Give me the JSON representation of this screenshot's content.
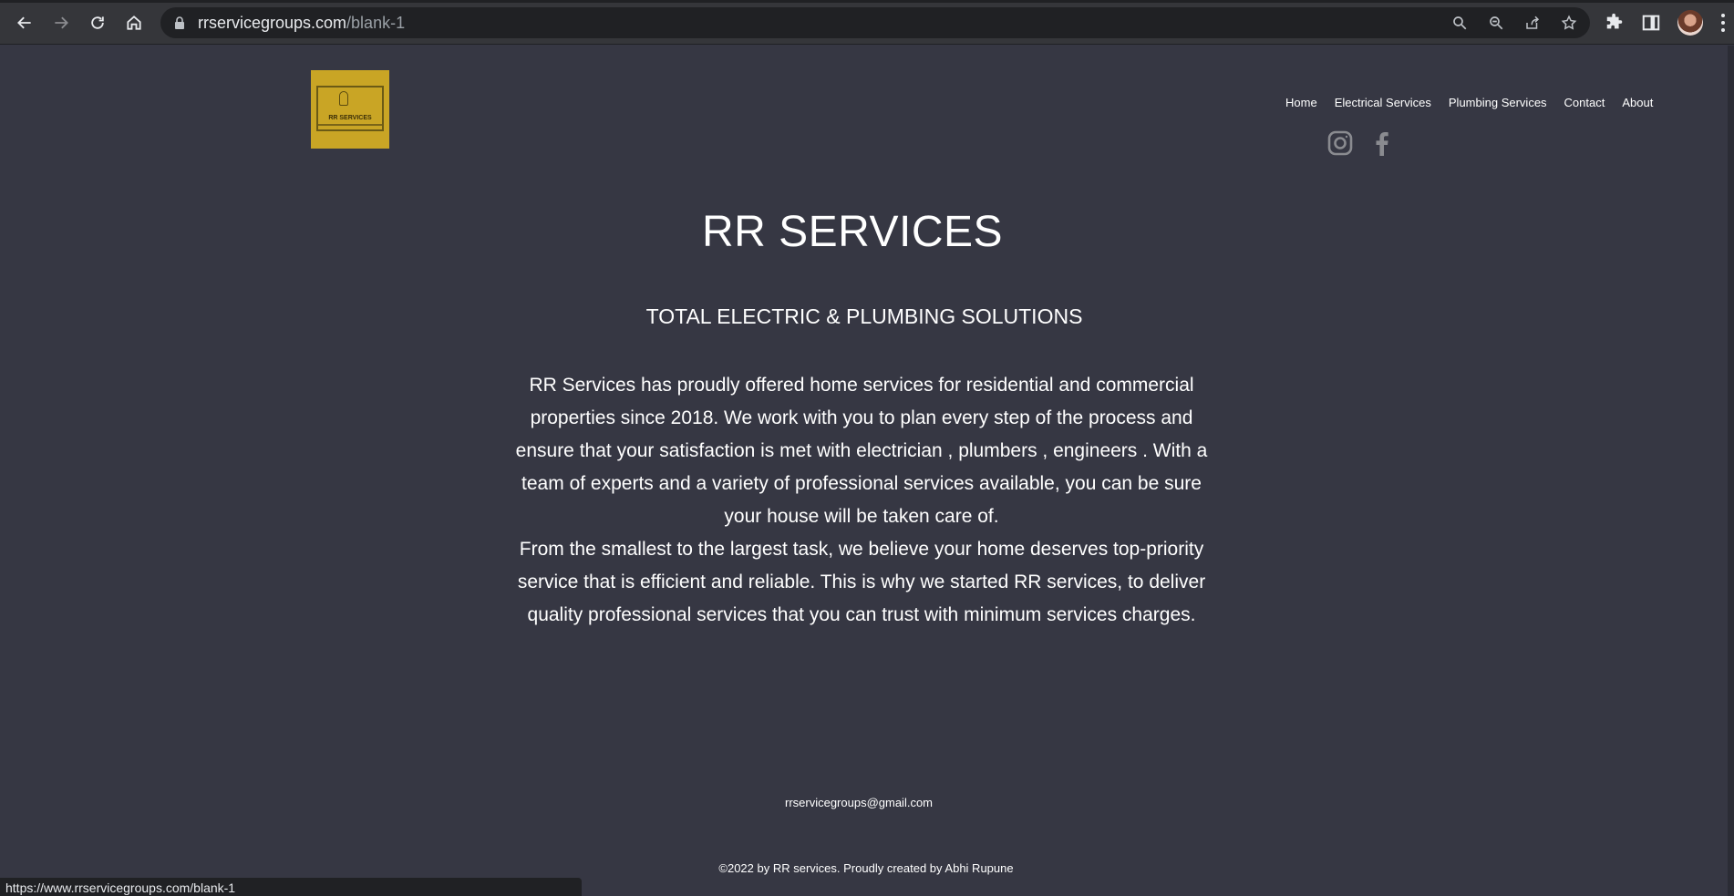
{
  "browser": {
    "url_host": "rrservicegroups.com",
    "url_path": "/blank-1",
    "icons": [
      "back-icon",
      "forward-icon",
      "reload-icon",
      "home-icon",
      "lock-icon",
      "search-icon",
      "zoom-icon",
      "share-icon",
      "star-icon",
      "extensions-icon",
      "side-panel-icon",
      "profile-avatar",
      "menu-icon"
    ]
  },
  "header": {
    "logo_text": "RR SERVICES",
    "nav": [
      {
        "label": "Home"
      },
      {
        "label": "Electrical Services"
      },
      {
        "label": "Plumbing Services"
      },
      {
        "label": "Contact"
      },
      {
        "label": "About"
      }
    ],
    "social": [
      "instagram-icon",
      "facebook-icon"
    ]
  },
  "main": {
    "title": "RR SERVICES",
    "subtitle": "TOTAL ELECTRIC & PLUMBING SOLUTIONS",
    "paragraph_1": "RR Services has proudly offered home services for residential and commercial properties since 2018. We work with you to plan every step of the process and ensure that your satisfaction is met with electrician , plumbers , engineers . With a team of experts and a variety of professional services available, you can be sure your house will be taken care of.",
    "paragraph_2": "From the smallest to the largest task, we believe your home deserves top-priority service that is efficient and reliable. This is why we started RR services, to deliver quality professional services that you can trust with minimum services charges."
  },
  "footer": {
    "email": "rrservicegroups@gmail.com",
    "copyright": "©2022 by RR services. Proudly created by Abhi Rupune"
  },
  "status_bar": {
    "link_url": "https://www.rrservicegroups.com/blank-1"
  },
  "colors": {
    "page_background": "#363743",
    "logo_background": "#c9a525",
    "text": "#ffffff",
    "social_icon": "#8a8b90"
  }
}
